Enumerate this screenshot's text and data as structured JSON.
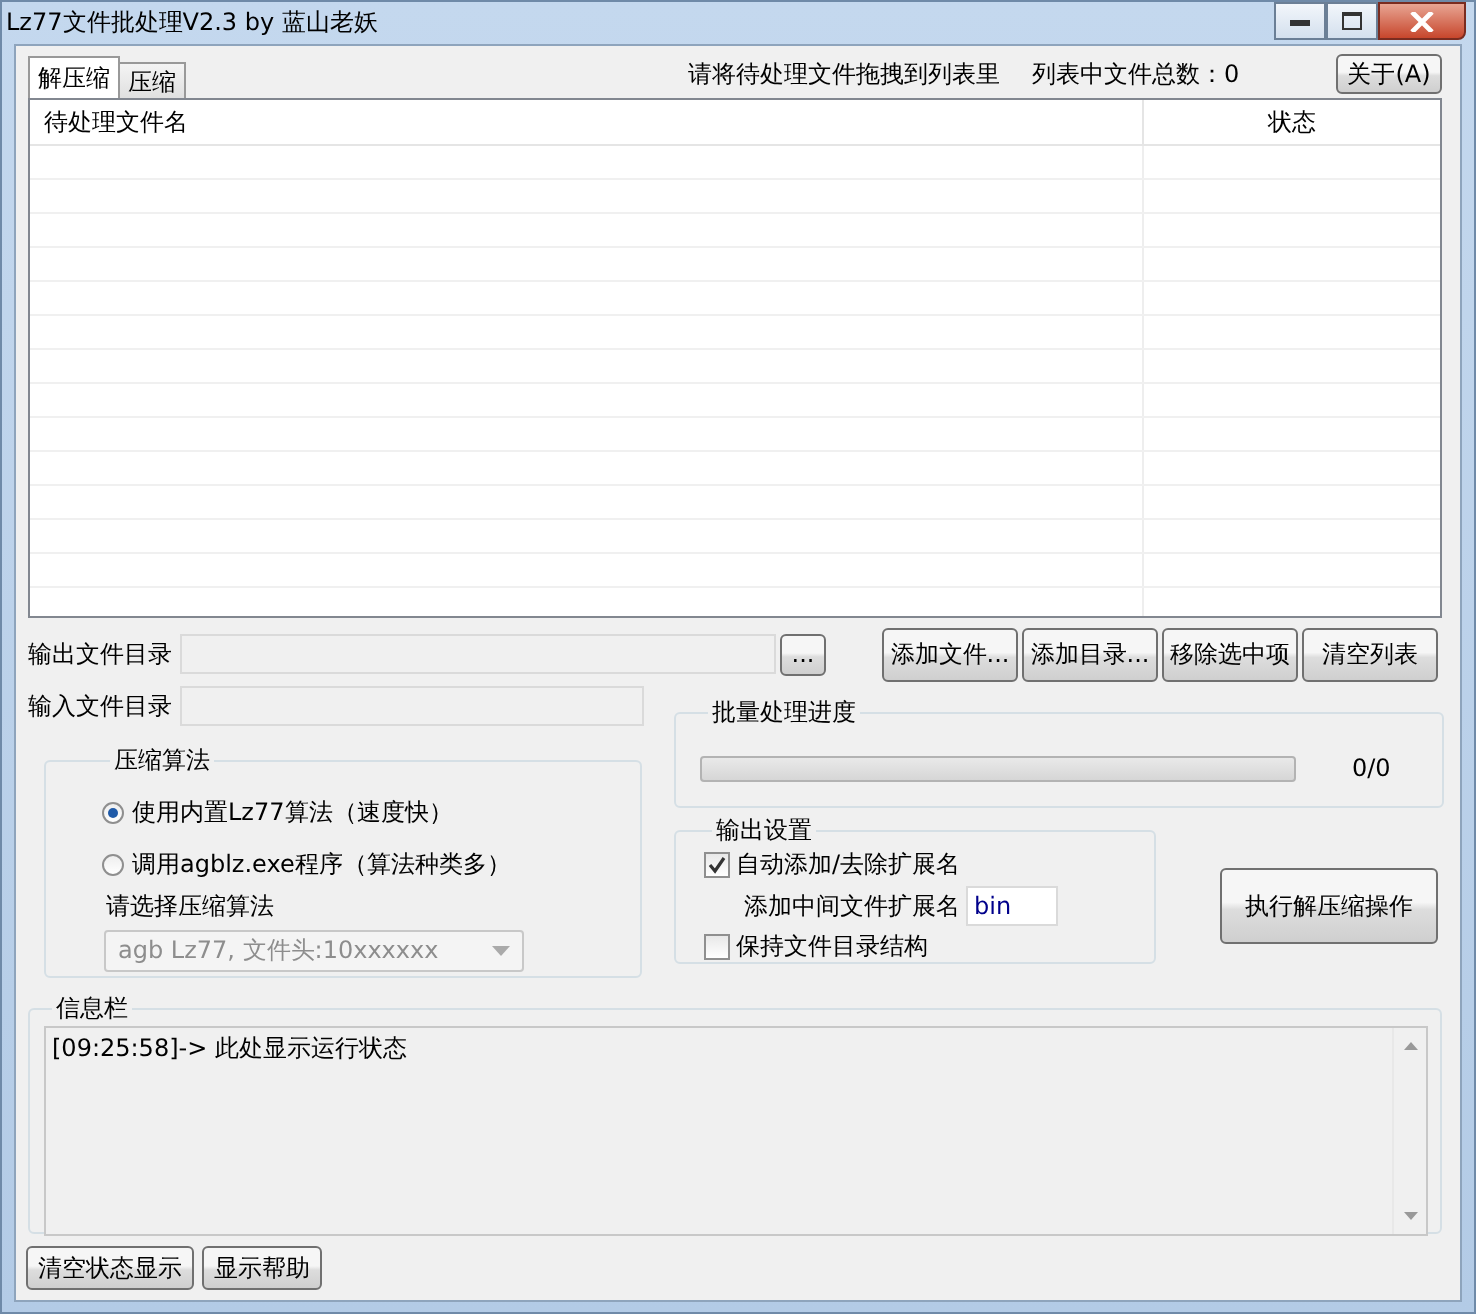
{
  "window": {
    "title": "Lz77文件批处理V2.3 by 蓝山老妖"
  },
  "tabs": [
    {
      "label": "解压缩",
      "selected": true
    },
    {
      "label": "压缩",
      "selected": false
    }
  ],
  "hint": "请将待处理文件拖拽到列表里",
  "file_count": "列表中文件总数：0",
  "about_button": "关于(A)",
  "table": {
    "columns": [
      "待处理文件名",
      "状态"
    ]
  },
  "output_dir": {
    "label": "输出文件目录",
    "browse_button": "..."
  },
  "list_buttons": [
    "添加文件...",
    "添加目录...",
    "移除选中项",
    "清空列表"
  ],
  "input_dir": {
    "label": "输入文件目录"
  },
  "progress": {
    "title": "批量处理进度",
    "level": 0,
    "reading": "0/0"
  },
  "algorithm": {
    "title": "压缩算法",
    "options": [
      {
        "label": "使用内置Lz77算法（速度快）",
        "selected": true
      },
      {
        "label": "调用agblz.exe程序（算法种类多）",
        "selected": false
      }
    ],
    "select_label": "请选择压缩算法",
    "select": {
      "value": "agb Lz77, 文件头:10xxxxxx",
      "disabled": true
    }
  },
  "output_settings": {
    "title": "输出设置",
    "auto_ext": {
      "label": "自动添加/去除扩展名",
      "checked": true
    },
    "ext_label": "添加中间文件扩展名",
    "ext_value": "bin",
    "keep_structure": {
      "label": "保持文件目录结构",
      "checked": false
    }
  },
  "execute_button": "执行解压缩操作",
  "info": {
    "title": "信息栏",
    "log": [
      "[09:25:58]-> 此处显示运行状态"
    ]
  },
  "bottom_buttons": [
    "清空状态显示",
    "显示帮助"
  ]
}
